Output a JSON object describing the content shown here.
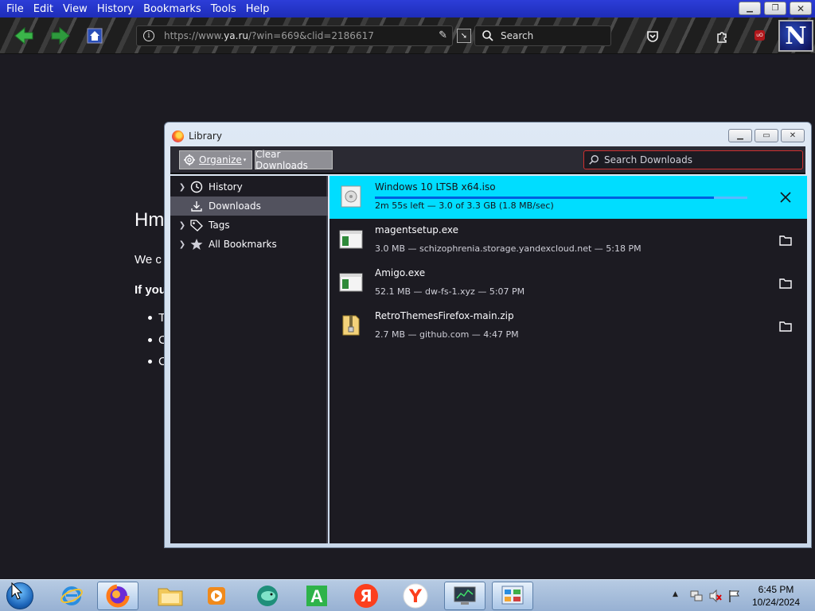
{
  "menubar": {
    "items": [
      "File",
      "Edit",
      "View",
      "History",
      "Bookmarks",
      "Tools",
      "Help"
    ]
  },
  "toolbar": {
    "url_prefix": "https://www.",
    "url_domain": "ya.ru",
    "url_suffix": "/?win=669&clid=2186617",
    "search_label": "Search"
  },
  "page": {
    "heading_fragment": "Hm",
    "para1_fragment": "We c",
    "para2_fragment": "If you",
    "bullets": [
      "T",
      "C",
      "C"
    ]
  },
  "library": {
    "title": "Library",
    "organize_label": "Organize",
    "clear_label": "Clear Downloads",
    "search_placeholder": "Search Downloads",
    "sidebar": [
      {
        "label": "History",
        "expandable": true,
        "icon": "clock-icon",
        "selected": false
      },
      {
        "label": "Downloads",
        "expandable": false,
        "icon": "download-icon",
        "selected": true
      },
      {
        "label": "Tags",
        "expandable": true,
        "icon": "tag-icon",
        "selected": false
      },
      {
        "label": "All Bookmarks",
        "expandable": true,
        "icon": "star-icon",
        "selected": false
      }
    ],
    "downloads": [
      {
        "name": "Windows 10 LTSB x64.iso",
        "status": "2m 55s left — 3.0 of 3.3 GB (1.8 MB/sec)",
        "active": true,
        "progress": 0.91,
        "icon": "disc-image-icon",
        "action": "cancel-icon"
      },
      {
        "name": "magentsetup.exe",
        "status": "3.0 MB — schizophrenia.storage.yandexcloud.net — 5:18 PM",
        "active": false,
        "icon": "executable-icon",
        "action": "folder-icon"
      },
      {
        "name": "Amigo.exe",
        "status": "52.1 MB — dw-fs-1.xyz — 5:07 PM",
        "active": false,
        "icon": "executable-icon",
        "action": "folder-icon"
      },
      {
        "name": "RetroThemesFirefox-main.zip",
        "status": "2.7 MB — github.com — 4:47 PM",
        "active": false,
        "icon": "zip-archive-icon",
        "action": "folder-icon"
      }
    ]
  },
  "taskbar": {
    "time": "6:45 PM",
    "date": "10/24/2024"
  },
  "colors": {
    "active_download": "#00ddff",
    "panel_bg": "#1c1b22",
    "search_border": "#d0302f"
  }
}
